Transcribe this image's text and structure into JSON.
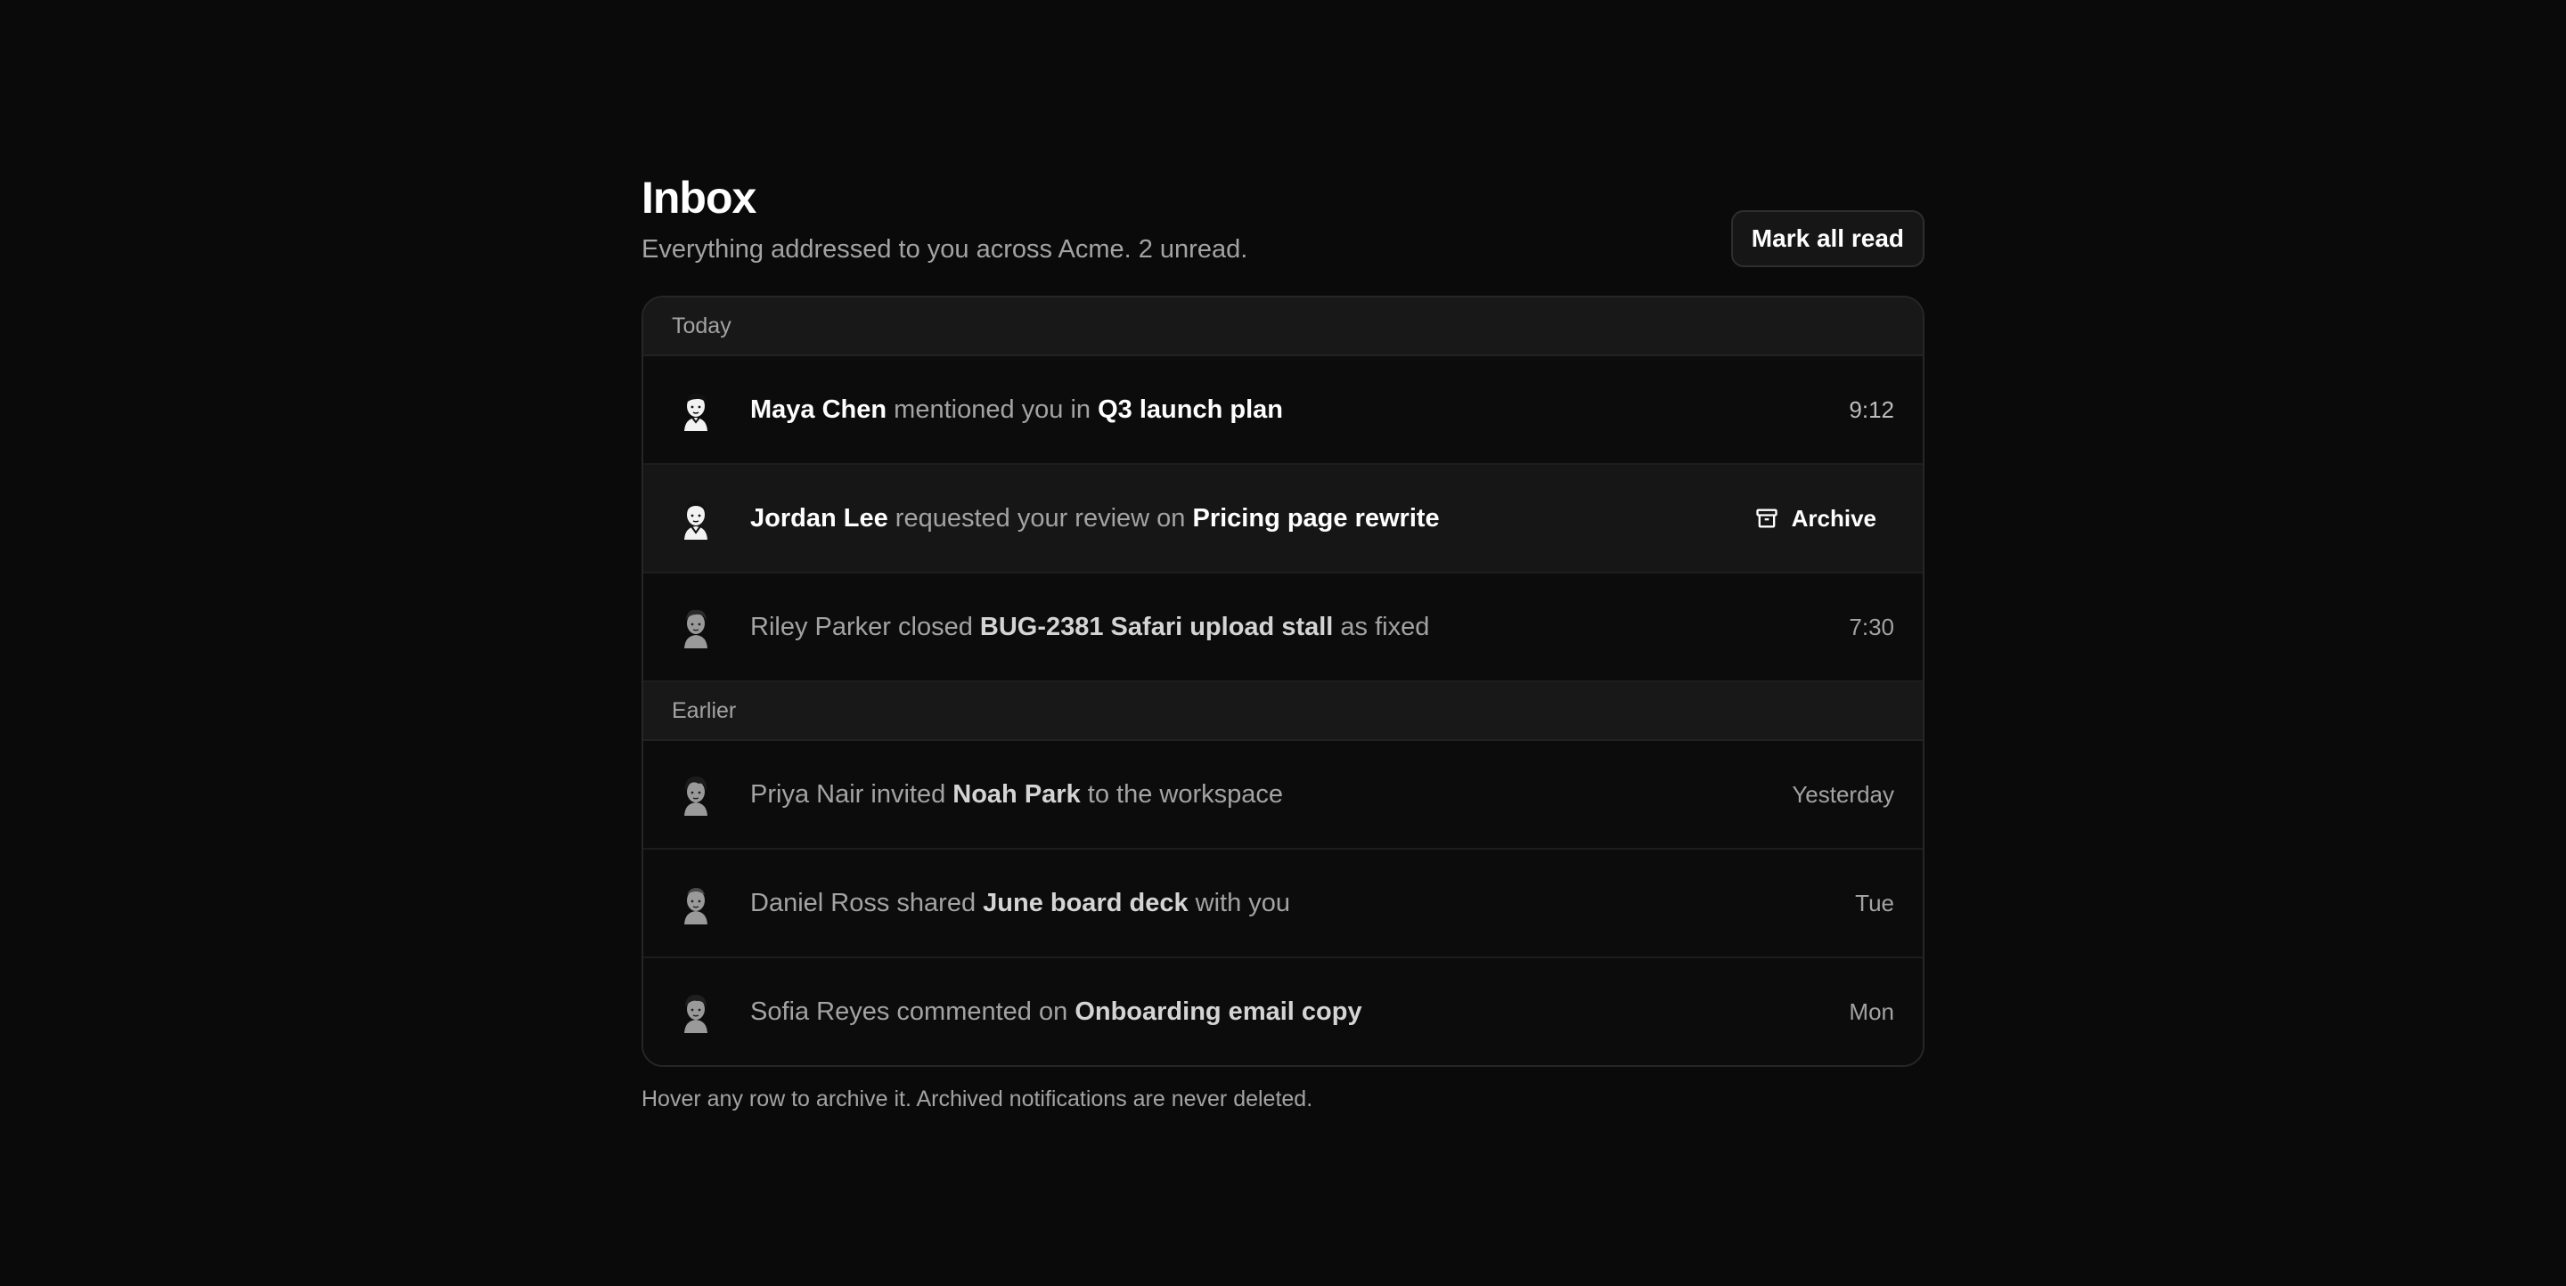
{
  "header": {
    "title": "Inbox",
    "subtitle": "Everything addressed to you across Acme. 2 unread.",
    "mark_all_label": "Mark all read"
  },
  "groups": [
    {
      "label": "Today",
      "items": [
        {
          "actor": "Maya Chen",
          "verb": "mentioned you in",
          "object": "Q3 launch plan",
          "suffix": "",
          "time": "9:12",
          "unread": true,
          "avatar_icon": "avatar-icon"
        },
        {
          "actor": "Jordan Lee",
          "verb": "requested your review on",
          "object": "Pricing page rewrite",
          "suffix": "",
          "time": "",
          "unread": true,
          "hovered": true,
          "action_label": "Archive",
          "avatar_icon": "avatar-icon"
        },
        {
          "actor": "Riley Parker",
          "verb": "closed",
          "object": "BUG-2381 Safari upload stall",
          "suffix": "as fixed",
          "time": "7:30",
          "unread": false,
          "avatar_icon": "avatar-icon"
        }
      ]
    },
    {
      "label": "Earlier",
      "items": [
        {
          "actor": "Priya Nair",
          "verb": "invited",
          "object": "Noah Park",
          "suffix": "to the workspace",
          "time": "Yesterday",
          "unread": false,
          "avatar_icon": "avatar-icon"
        },
        {
          "actor": "Daniel Ross",
          "verb": "shared",
          "object": "June board deck",
          "suffix": "with you",
          "time": "Tue",
          "unread": false,
          "avatar_icon": "avatar-icon"
        },
        {
          "actor": "Sofia Reyes",
          "verb": "commented on",
          "object": "Onboarding email copy",
          "suffix": "",
          "time": "Mon",
          "unread": false,
          "avatar_icon": "avatar-icon"
        }
      ]
    }
  ],
  "footnote": "Hover any row to archive it. Archived notifications are never deleted.",
  "colors": {
    "background": "#0a0a0a",
    "card": "#0c0c0c",
    "group_header": "#181818",
    "muted_text": "#a3a3a3",
    "primary_text": "#ffffff"
  }
}
